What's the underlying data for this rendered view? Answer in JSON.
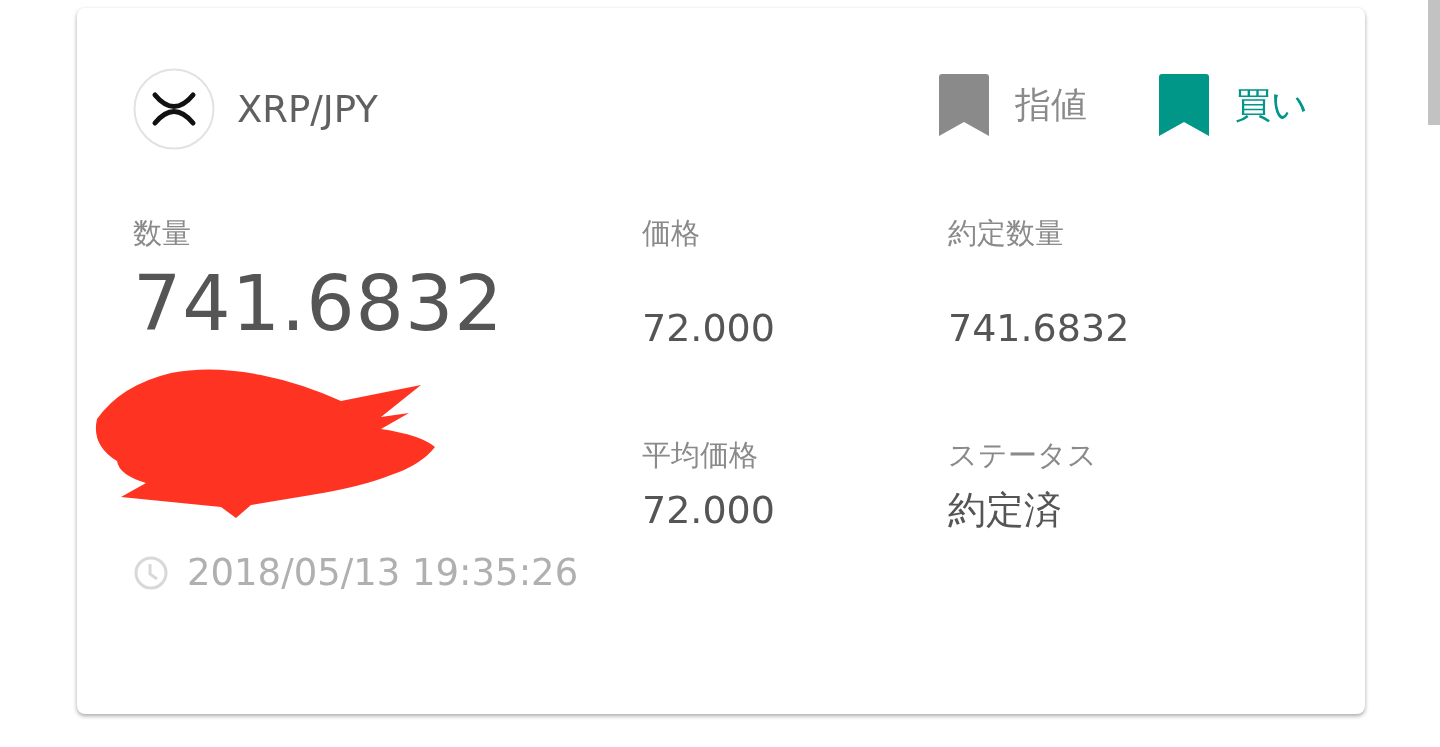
{
  "pair": {
    "symbol": "XRP/JPY"
  },
  "tags": [
    {
      "label": "指値",
      "color": "#8a8a8a"
    },
    {
      "label": "買い",
      "color": "#009688"
    }
  ],
  "quantity": {
    "label": "数量",
    "value": "741.6832"
  },
  "fields": [
    {
      "label": "価格",
      "value": "72.000"
    },
    {
      "label": "約定数量",
      "value": "741.6832"
    },
    {
      "label": "平均価格",
      "value": "72.000"
    },
    {
      "label": "ステータス",
      "value": "約定済"
    }
  ],
  "timestamp": "2018/05/13 19:35:26"
}
